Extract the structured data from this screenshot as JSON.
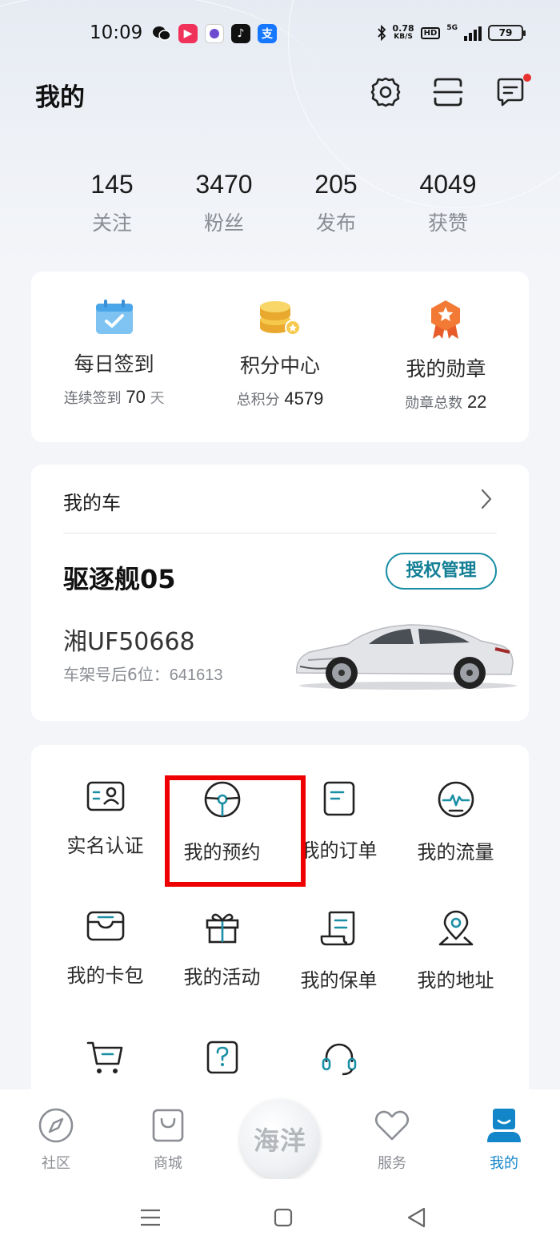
{
  "status_bar": {
    "time": "10:09",
    "net_speed": "0.78",
    "net_unit": "KB/S",
    "hd": "HD",
    "signal": "5G",
    "battery": "79"
  },
  "header": {
    "title": "我的"
  },
  "stats": [
    {
      "value": "145",
      "label": "关注"
    },
    {
      "value": "3470",
      "label": "粉丝"
    },
    {
      "value": "205",
      "label": "发布"
    },
    {
      "value": "4049",
      "label": "获赞"
    }
  ],
  "rewards": [
    {
      "title": "每日签到",
      "sub_prefix": "连续签到",
      "value": "70",
      "sub_suffix": "天"
    },
    {
      "title": "积分中心",
      "sub_prefix": "总积分",
      "value": "4579",
      "sub_suffix": ""
    },
    {
      "title": "我的勋章",
      "sub_prefix": "勋章总数",
      "value": "22",
      "sub_suffix": ""
    }
  ],
  "car": {
    "section_title": "我的车",
    "model": "驱逐舰05",
    "auth_button": "授权管理",
    "plate": "湘UF50668",
    "vin_label": "车架号后6位：",
    "vin_value": "641613"
  },
  "services": [
    {
      "label": "实名认证",
      "icon": "id-card-icon"
    },
    {
      "label": "我的预约",
      "icon": "steering-wheel-icon"
    },
    {
      "label": "我的订单",
      "icon": "order-icon"
    },
    {
      "label": "我的流量",
      "icon": "data-flow-icon"
    },
    {
      "label": "我的卡包",
      "icon": "card-wallet-icon"
    },
    {
      "label": "我的活动",
      "icon": "gift-icon"
    },
    {
      "label": "我的保单",
      "icon": "policy-icon"
    },
    {
      "label": "我的地址",
      "icon": "location-icon"
    }
  ],
  "tabbar": {
    "community": "社区",
    "mall": "商城",
    "center": "海洋",
    "service": "服务",
    "mine": "我的"
  },
  "colors": {
    "accent": "#1386c9",
    "teal": "#1a8fa5",
    "highlight": "#ee0000"
  }
}
